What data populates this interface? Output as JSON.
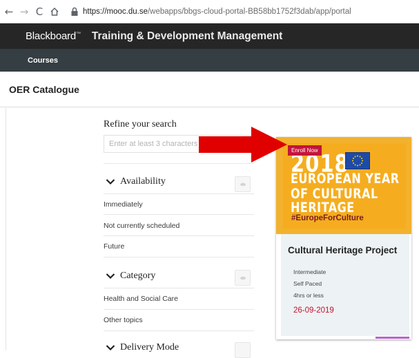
{
  "browser": {
    "url_host": "https://mooc.du.se",
    "url_path": "/webapps/bbgs-cloud-portal-BB58bb1752f3dab/app/portal"
  },
  "header": {
    "brand": "Blackboard",
    "title": "Training & Development Management"
  },
  "nav": {
    "courses": "Courses"
  },
  "page": {
    "title": "OER Catalogue"
  },
  "refine": {
    "title": "Refine your search",
    "search_placeholder": "Enter at least 3 characters",
    "facets": [
      {
        "label": "Availability",
        "items": [
          "Immediately",
          "Not currently scheduled",
          "Future"
        ]
      },
      {
        "label": "Category",
        "items": [
          "Health and Social Care",
          "Other topics"
        ]
      },
      {
        "label": "Delivery Mode",
        "items": []
      }
    ]
  },
  "card": {
    "badge": "Enroll Now",
    "poster": {
      "year": "2018",
      "line2": "EUROPEAN YEAR",
      "line3": "OF CULTURAL",
      "line4": "HERITAGE",
      "hashtag": "#EuropeForCulture"
    },
    "title": "Cultural Heritage Project",
    "level": "Intermediate",
    "pace": "Self Paced",
    "duration": "4hrs or less",
    "date": "26-09-2019"
  },
  "colors": {
    "header_bg": "#262626",
    "nav_bg": "#353e42",
    "poster_bg": "#f5ad1f",
    "badge_bg": "#c3153a",
    "date_red": "#c8102e",
    "arrow_red": "#e00000"
  }
}
